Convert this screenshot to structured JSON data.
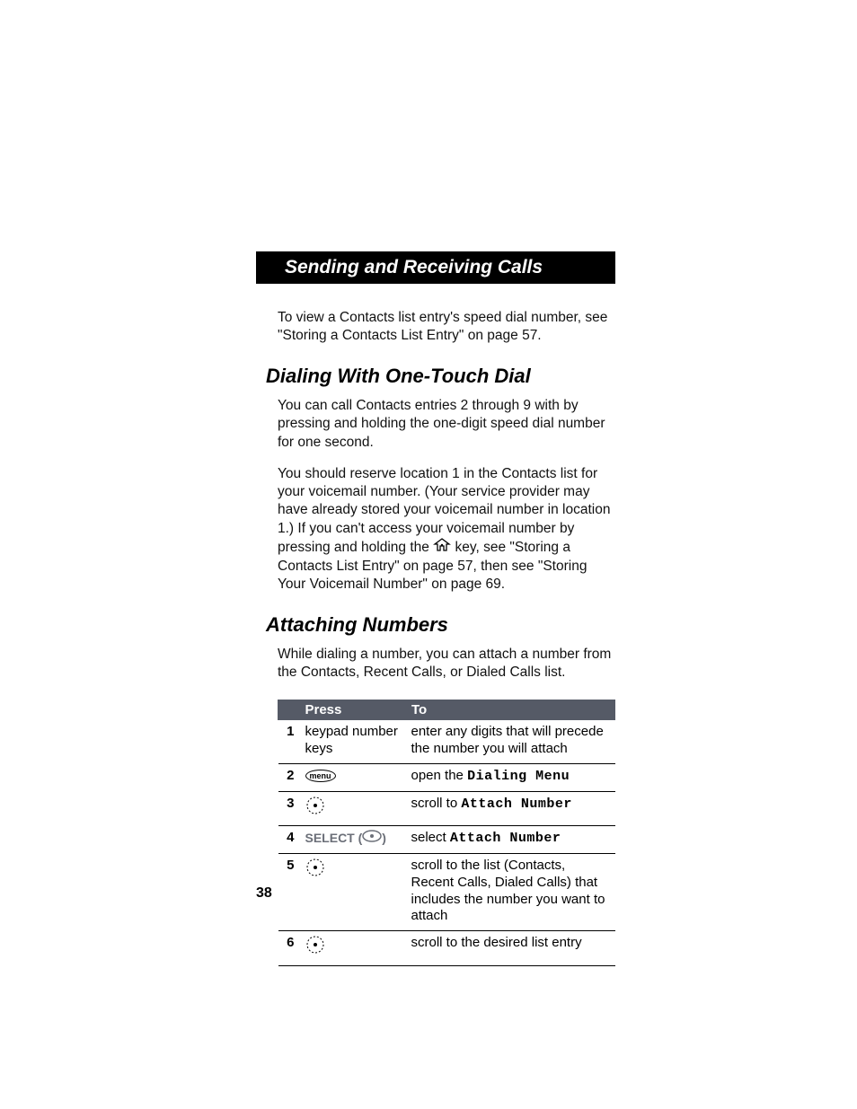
{
  "titlebar": "Sending and Receiving Calls",
  "intro_para": "To view a Contacts list entry's speed dial number, see \"Storing a Contacts List Entry\" on page 57.",
  "h2_one_touch": "Dialing With One-Touch Dial",
  "one_touch_p1": "You can call Contacts entries 2 through 9 with by pressing and holding the one-digit speed dial number for one second.",
  "one_touch_p2_a": "You should reserve location 1 in the Contacts list for your voicemail number. (Your service provider may have already stored your voicemail number in location 1.) If you can't access your voicemail number by pressing and holding the ",
  "one_touch_p2_b": " key, see \"Storing a Contacts List Entry\" on page 57, then see \"Storing Your Voicemail Number\" on page 69.",
  "h2_attach": "Attaching Numbers",
  "attach_p1": "While dialing a number, you can attach a number from the Contacts, Recent Calls, or Dialed Calls list.",
  "table": {
    "head_press": "Press",
    "head_to": "To",
    "rows": [
      {
        "n": "1",
        "press_text": "keypad number keys",
        "to_a": "enter any digits that will precede the number you will attach"
      },
      {
        "n": "2",
        "press_icon": "menu",
        "to_a": "open the ",
        "to_lcd": "Dialing Menu"
      },
      {
        "n": "3",
        "press_icon": "nav",
        "to_a": "scroll to ",
        "to_lcd": "Attach Number"
      },
      {
        "n": "4",
        "press_select": "SELECT",
        "to_a": "select ",
        "to_lcd": "Attach Number"
      },
      {
        "n": "5",
        "press_icon": "nav",
        "to_a": "scroll to the list (Contacts, Recent Calls, Dialed Calls) that includes the number you want to attach"
      },
      {
        "n": "6",
        "press_icon": "nav",
        "to_a": "scroll to the desired list entry"
      }
    ]
  },
  "icon_labels": {
    "menu": "menu",
    "select_paren_open": " (",
    "select_paren_close": ")"
  },
  "page_number": "38"
}
